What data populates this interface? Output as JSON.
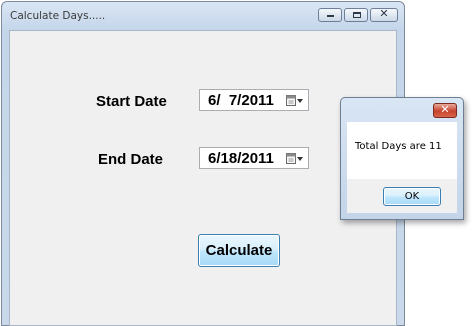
{
  "main_window": {
    "title": "Calculate Days.....",
    "start_label": "Start Date",
    "start_value": "6/  7/2011",
    "end_label": "End Date",
    "end_value": "6/18/2011",
    "calculate_label": "Calculate"
  },
  "message_box": {
    "text": "Total Days are 11",
    "ok_label": "OK"
  },
  "icons": {
    "minimize": "minimize-icon",
    "maximize": "maximize-icon",
    "close": "close-icon",
    "calendar": "calendar-dropdown-icon"
  },
  "colors": {
    "close_button": "#c6432c",
    "button_border": "#3c7fb1",
    "client_background": "#f0f0f0"
  }
}
